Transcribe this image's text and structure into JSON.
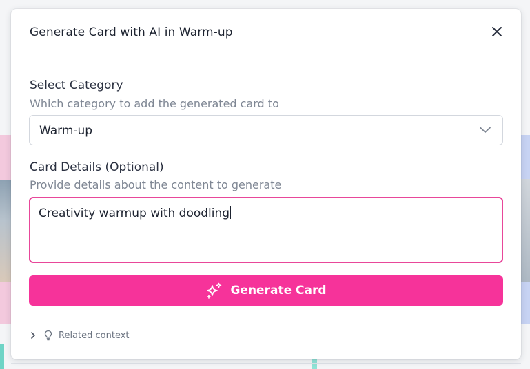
{
  "modal": {
    "title": "Generate Card with AI in Warm-up",
    "close_icon": "close-icon"
  },
  "category": {
    "label": "Select Category",
    "hint": "Which category to add the generated card to",
    "selected": "Warm-up",
    "icon": "chevron-down-icon"
  },
  "details": {
    "label": "Card Details (Optional)",
    "hint": "Provide details about the content to generate",
    "value": "Creativity warmup with doodling",
    "focus_color": "#e8479a"
  },
  "generate_button": {
    "label": "Generate Card",
    "icon": "sparkle-icon",
    "color": "#f6339a"
  },
  "related_context": {
    "label": "Related context",
    "icons": [
      "chevron-right-icon",
      "lightbulb-icon"
    ]
  }
}
